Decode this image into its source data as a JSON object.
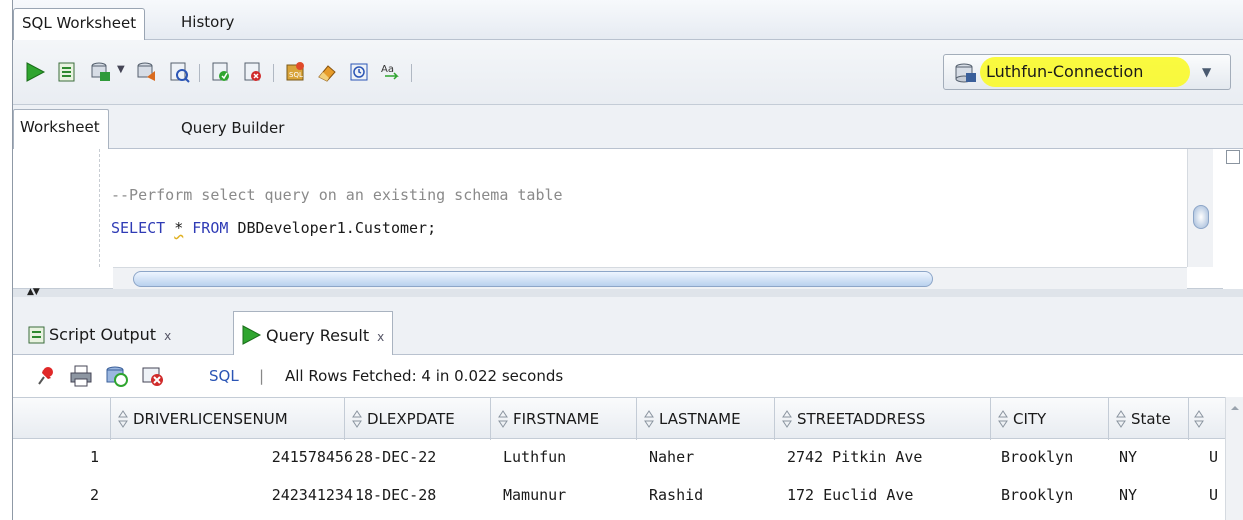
{
  "doc_tabs": [
    "SQL Worksheet",
    "History"
  ],
  "toolbar": {
    "icons": [
      "run-statement-icon",
      "run-script-icon",
      "commit-icon",
      "rollback-icon",
      "autotrace-icon",
      "explain-plan-icon",
      "clear-icon",
      "sql-tuning-icon",
      "eraser-icon",
      "history-icon",
      "format-icon"
    ],
    "connection": "Luthfun-Connection"
  },
  "worksheet_tabs": [
    "Worksheet",
    "Query Builder"
  ],
  "editor": {
    "comment": "--Perform select query on an existing schema table",
    "kw_select": "SELECT",
    "star": "*",
    "kw_from": "FROM",
    "table": "DBDeveloper1.Customer;"
  },
  "result_tabs": [
    "Script Output",
    "Query Result"
  ],
  "result_toolbar": {
    "sql_label": "SQL",
    "separator": "|",
    "status": "All Rows Fetched: 4 in 0.022 seconds"
  },
  "grid": {
    "columns": [
      "DRIVERLICENSENUM",
      "DLEXPDATE",
      "FIRSTNAME",
      "LASTNAME",
      "STREETADDRESS",
      "CITY",
      "State"
    ],
    "rows": [
      {
        "n": "1",
        "cells": [
          "241578456",
          "28-DEC-22",
          "Luthfun",
          "Naher",
          "2742 Pitkin Ave",
          "Brooklyn",
          "NY",
          "U"
        ]
      },
      {
        "n": "2",
        "cells": [
          "242341234",
          "18-DEC-28",
          "Mamunur",
          "Rashid",
          "172 Euclid Ave",
          "Brooklyn",
          "NY",
          "U"
        ]
      }
    ]
  },
  "colors": {
    "highlight": "#fafa2a",
    "keyword": "#2f3bb5",
    "comment": "#8a8a8a",
    "link": "#2b55b5"
  }
}
